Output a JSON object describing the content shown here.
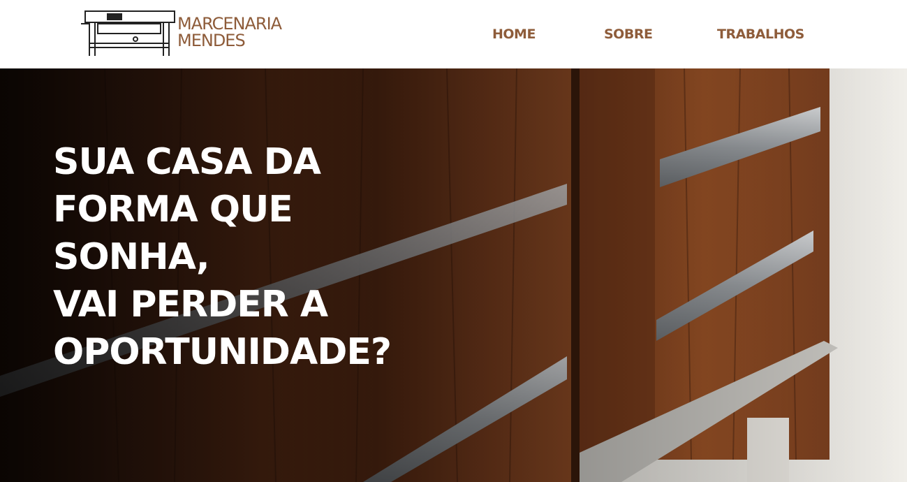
{
  "brand": {
    "line1": "MARCENARIA",
    "line2": "MENDES",
    "logo_icon": "workbench-icon",
    "color": "#8e5c3a"
  },
  "nav": {
    "items": [
      {
        "label": "HOME"
      },
      {
        "label": "SOBRE"
      },
      {
        "label": "TRABALHOS"
      }
    ]
  },
  "hero": {
    "headline_lines": [
      "SUA CASA DA",
      "FORMA QUE",
      "SONHA,",
      "VAI PERDER A",
      "OPORTUNIDADE?"
    ],
    "background": "wood-cabinet-photo"
  }
}
